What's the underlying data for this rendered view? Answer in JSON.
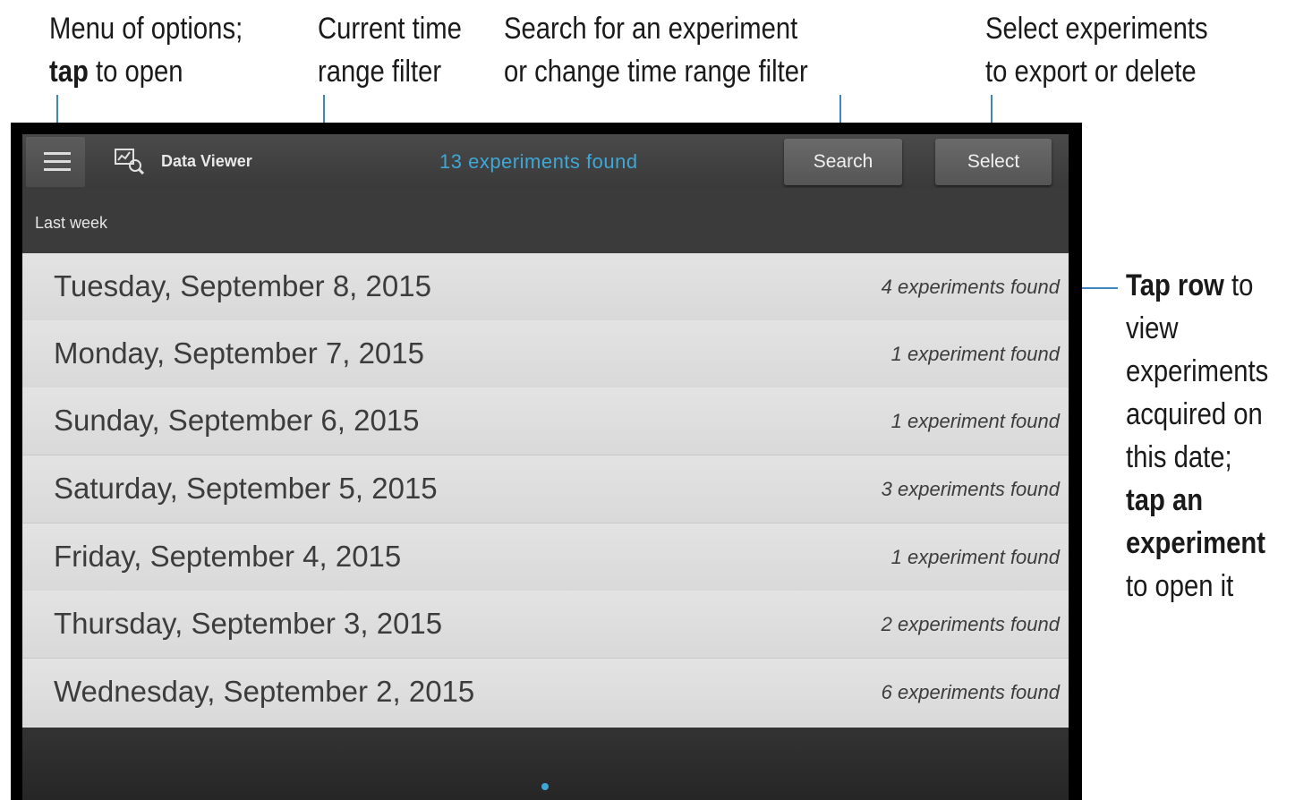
{
  "callouts": {
    "menu": {
      "line1": "Menu of options;",
      "line2_bold": "tap",
      "line2_rest": " to open"
    },
    "time_range": {
      "line1": "Current time",
      "line2": "range filter"
    },
    "search": {
      "line1": "Search for an experiment",
      "line2": "or change time range filter"
    },
    "select": {
      "line1": "Select experiments",
      "line2": "to export or delete"
    },
    "tap_row": {
      "bold1": "Tap row",
      "rest1": " to",
      "line2": "view",
      "line3": "experiments",
      "line4": "acquired on",
      "line5": "this date;",
      "bold6": "tap an",
      "bold7": "experiment",
      "line8": "to open it"
    }
  },
  "app": {
    "title": "Data Viewer",
    "found_title": "13 experiments found",
    "search_label": "Search",
    "select_label": "Select",
    "filter_label": "Last week"
  },
  "rows": [
    {
      "date": "Tuesday, September 8, 2015",
      "count": "4 experiments found"
    },
    {
      "date": "Monday, September 7, 2015",
      "count": "1 experiment found"
    },
    {
      "date": "Sunday, September 6, 2015",
      "count": "1 experiment found"
    },
    {
      "date": "Saturday, September 5, 2015",
      "count": "3 experiments found"
    },
    {
      "date": "Friday, September 4, 2015",
      "count": "1 experiment found"
    },
    {
      "date": "Thursday, September 3, 2015",
      "count": "2 experiments found"
    },
    {
      "date": "Wednesday, September 2, 2015",
      "count": "6 experiments found"
    }
  ],
  "colors": {
    "accent": "#3ea7d6",
    "leader_line": "#3b86c4",
    "list_background": "#dedede",
    "bar_background": "#3b3b3b"
  },
  "icons": [
    "menu-icon",
    "data-viewer-icon"
  ]
}
